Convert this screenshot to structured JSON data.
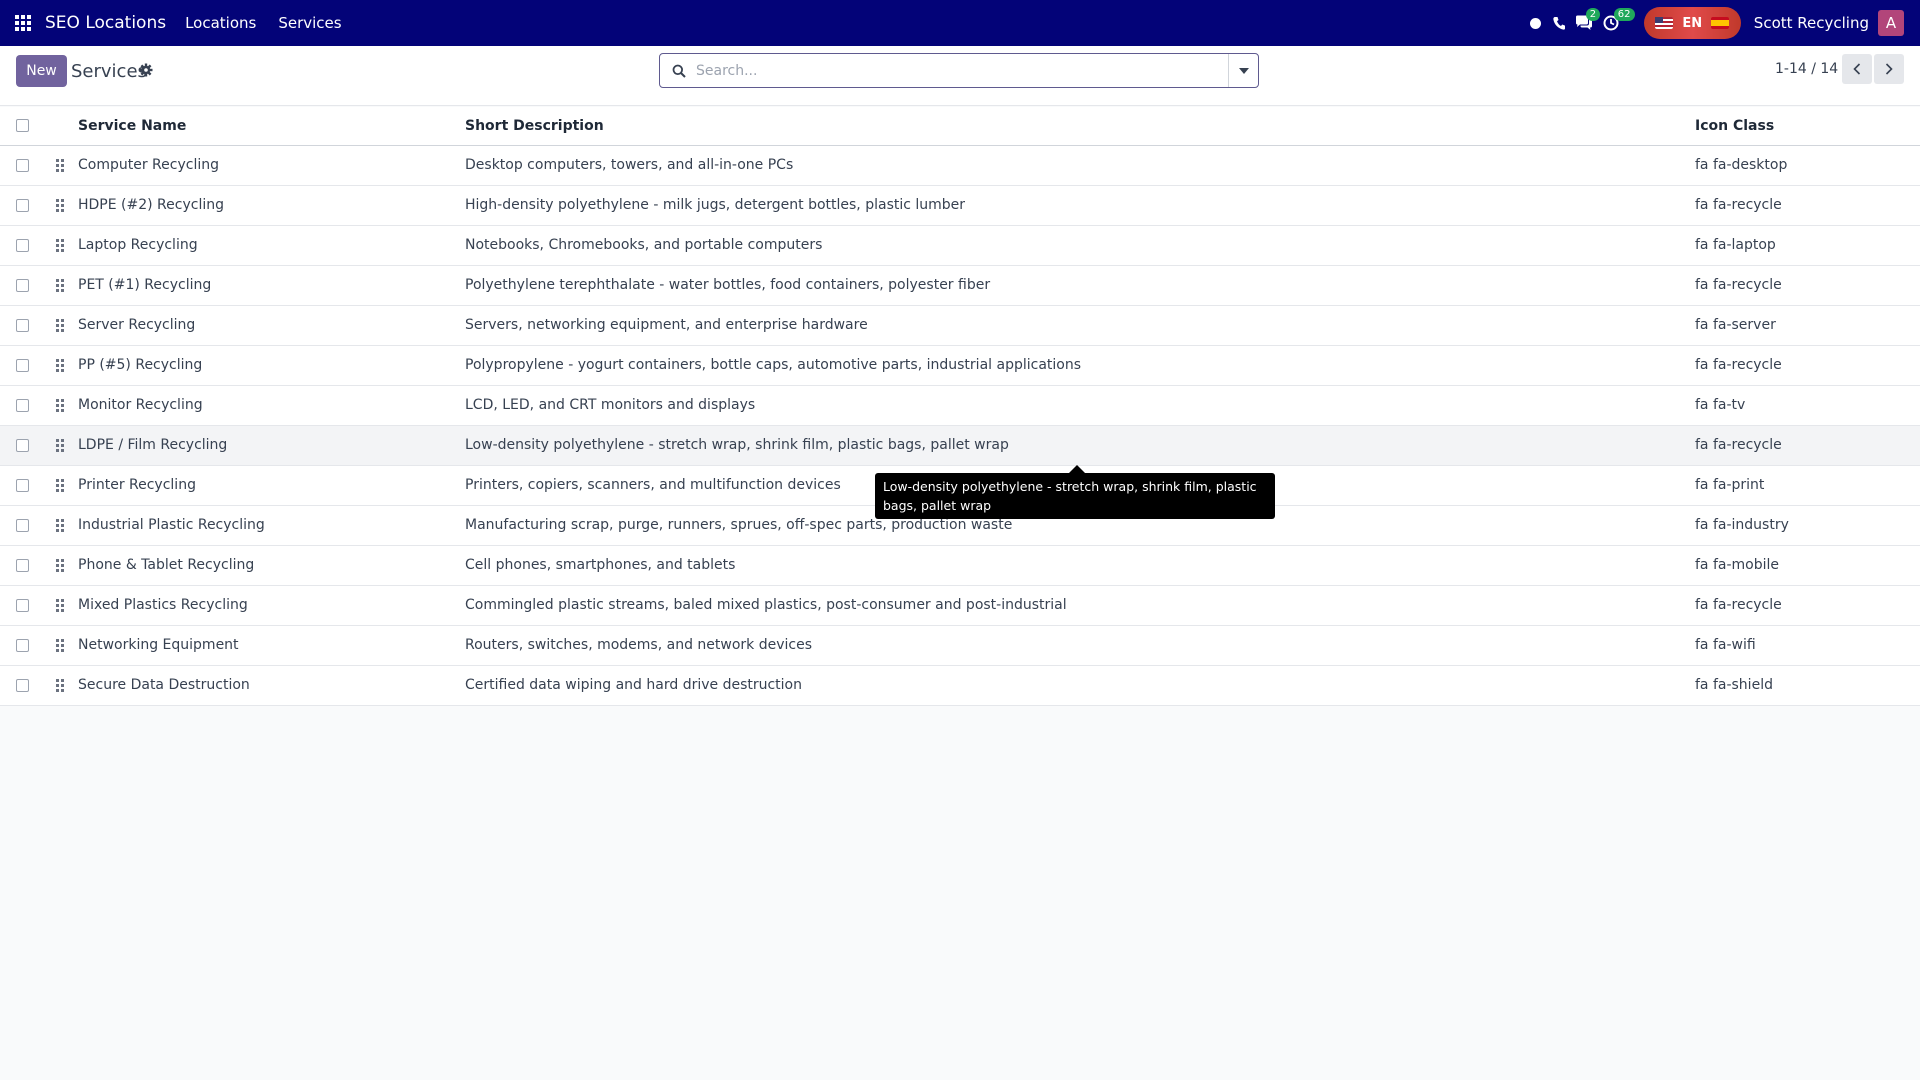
{
  "navbar": {
    "app_name": "SEO Locations",
    "menus": [
      "Locations",
      "Services"
    ],
    "chat_badge": "2",
    "activity_badge": "62",
    "lang_label": "EN",
    "company": "Scott Recycling",
    "avatar_letter": "A",
    "bg_color": "#030378"
  },
  "control_panel": {
    "new_label": "New",
    "title": "Services",
    "search_placeholder": "Search...",
    "pager": "1-14 / 14",
    "accent_color": "#71639e"
  },
  "table": {
    "columns": {
      "name": "Service Name",
      "description": "Short Description",
      "icon_class": "Icon Class"
    },
    "rows": [
      {
        "name": "Computer Recycling",
        "description": "Desktop computers, towers, and all-in-one PCs",
        "icon_class": "fa fa-desktop"
      },
      {
        "name": "HDPE (#2) Recycling",
        "description": "High-density polyethylene - milk jugs, detergent bottles, plastic lumber",
        "icon_class": "fa fa-recycle"
      },
      {
        "name": "Laptop Recycling",
        "description": "Notebooks, Chromebooks, and portable computers",
        "icon_class": "fa fa-laptop"
      },
      {
        "name": "PET (#1) Recycling",
        "description": "Polyethylene terephthalate - water bottles, food containers, polyester fiber",
        "icon_class": "fa fa-recycle"
      },
      {
        "name": "Server Recycling",
        "description": "Servers, networking equipment, and enterprise hardware",
        "icon_class": "fa fa-server"
      },
      {
        "name": "PP (#5) Recycling",
        "description": "Polypropylene - yogurt containers, bottle caps, automotive parts, industrial applications",
        "icon_class": "fa fa-recycle"
      },
      {
        "name": "Monitor Recycling",
        "description": "LCD, LED, and CRT monitors and displays",
        "icon_class": "fa fa-tv"
      },
      {
        "name": "LDPE / Film Recycling",
        "description": "Low-density polyethylene - stretch wrap, shrink film, plastic bags, pallet wrap",
        "icon_class": "fa fa-recycle"
      },
      {
        "name": "Printer Recycling",
        "description": "Printers, copiers, scanners, and multifunction devices",
        "icon_class": "fa fa-print"
      },
      {
        "name": "Industrial Plastic Recycling",
        "description": "Manufacturing scrap, purge, runners, sprues, off-spec parts, production waste",
        "icon_class": "fa fa-industry"
      },
      {
        "name": "Phone & Tablet Recycling",
        "description": "Cell phones, smartphones, and tablets",
        "icon_class": "fa fa-mobile"
      },
      {
        "name": "Mixed Plastics Recycling",
        "description": "Commingled plastic streams, baled mixed plastics, post-consumer and post-industrial",
        "icon_class": "fa fa-recycle"
      },
      {
        "name": "Networking Equipment",
        "description": "Routers, switches, modems, and network devices",
        "icon_class": "fa fa-wifi"
      },
      {
        "name": "Secure Data Destruction",
        "description": "Certified data wiping and hard drive destruction",
        "icon_class": "fa fa-shield"
      }
    ]
  },
  "tooltip": {
    "text": "Low-density polyethylene - stretch wrap, shrink film, plastic bags, pallet wrap"
  }
}
